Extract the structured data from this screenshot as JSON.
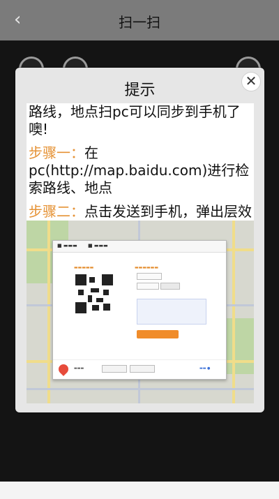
{
  "header": {
    "back_glyph": "‹",
    "title": "扫一扫"
  },
  "modal": {
    "title": "提示",
    "close_glyph": "✕",
    "line1": "路线，地点扫pc可以同步到手机了噢!",
    "step1_label": "步骤一：",
    "step1_text": "在pc(http://map.baidu.com)进行检索路线、地点",
    "step2_label": "步骤二：",
    "step2_text": "点击发送到手机，弹出层效果如下：扫一扫即可"
  },
  "colors": {
    "step_accent": "#e59235",
    "topbar": "#7b7b7b"
  }
}
